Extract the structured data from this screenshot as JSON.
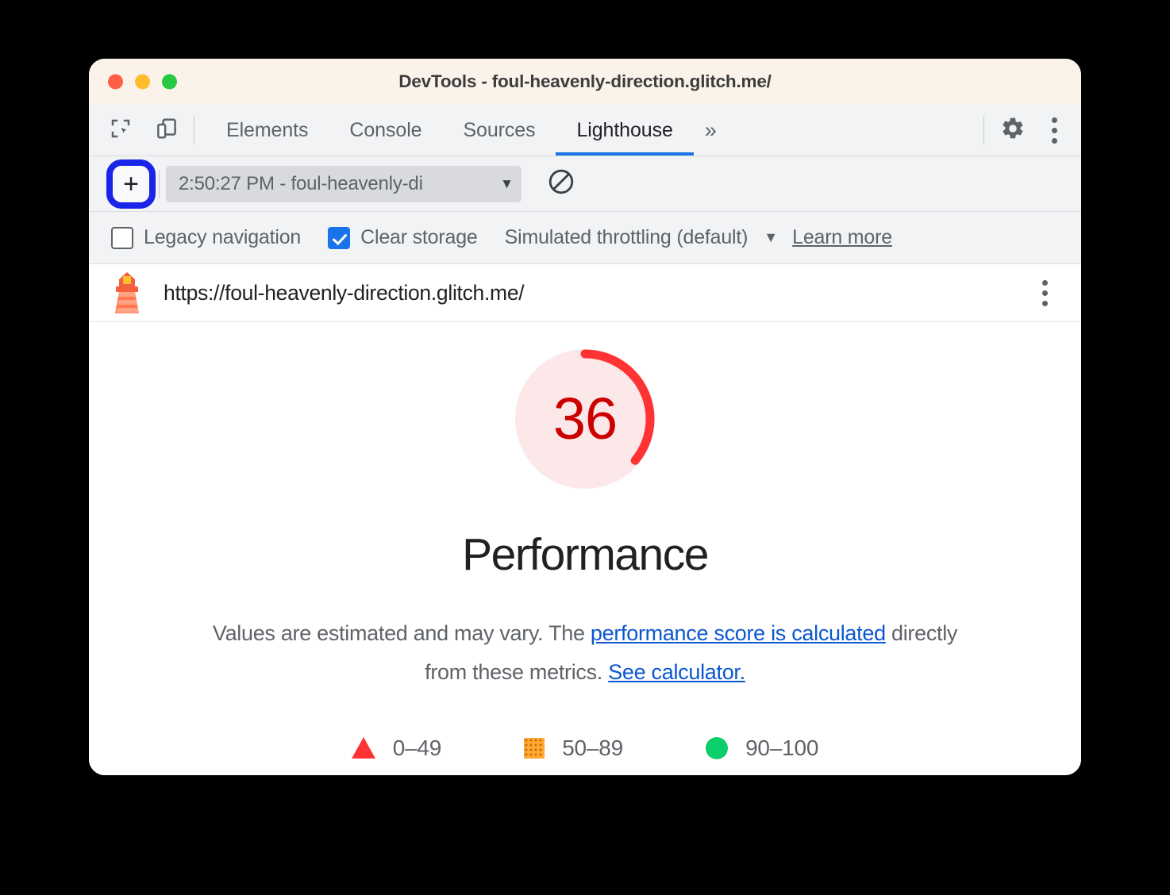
{
  "window": {
    "title": "DevTools - foul-heavenly-direction.glitch.me/",
    "traffic_lights": [
      "close",
      "minimize",
      "maximize"
    ]
  },
  "tabbar": {
    "tools": [
      {
        "name": "inspect-element-icon",
        "label": "Inspect element"
      },
      {
        "name": "device-toolbar-icon",
        "label": "Toggle device toolbar"
      }
    ],
    "tabs": [
      {
        "label": "Elements",
        "selected": false
      },
      {
        "label": "Console",
        "selected": false
      },
      {
        "label": "Sources",
        "selected": false
      },
      {
        "label": "Lighthouse",
        "selected": true
      }
    ],
    "overflow_label": "»",
    "settings_icon": "gear-icon",
    "more_icon": "kebab-menu-icon"
  },
  "actionbar": {
    "add_label": "+",
    "run_select_value": "2:50:27 PM - foul-heavenly-di",
    "run_select_arrow": "▼",
    "clear_icon": "clear-all-icon",
    "highlight_color": "#1a25e8"
  },
  "options": {
    "legacy_navigation": {
      "label": "Legacy navigation",
      "checked": false
    },
    "clear_storage": {
      "label": "Clear storage",
      "checked": true
    },
    "throttling": {
      "label": "Simulated throttling (default)",
      "arrow": "▼"
    },
    "learn_more": "Learn more"
  },
  "report": {
    "icon": "lighthouse-icon",
    "url": "https://foul-heavenly-direction.glitch.me/",
    "menu_icon": "kebab-menu-icon"
  },
  "chart_data": {
    "type": "gauge",
    "title": "Performance",
    "value": 36,
    "min": 0,
    "max": 100,
    "score_label": "36",
    "score_color": "#cc0000",
    "arc_color": "#f33",
    "track_color": "#fce8e8",
    "rating": "fail",
    "description_prefix": "Values are estimated and may vary. The ",
    "description_link1": "performance score is calculated",
    "description_middle": " directly from these metrics. ",
    "description_link2": "See calculator.",
    "legend": [
      {
        "shape": "triangle",
        "color": "#ff3333",
        "range": "0–49"
      },
      {
        "shape": "square",
        "color": "#ffaa33",
        "range": "50–89"
      },
      {
        "shape": "circle",
        "color": "#0cce6b",
        "range": "90–100"
      }
    ]
  }
}
